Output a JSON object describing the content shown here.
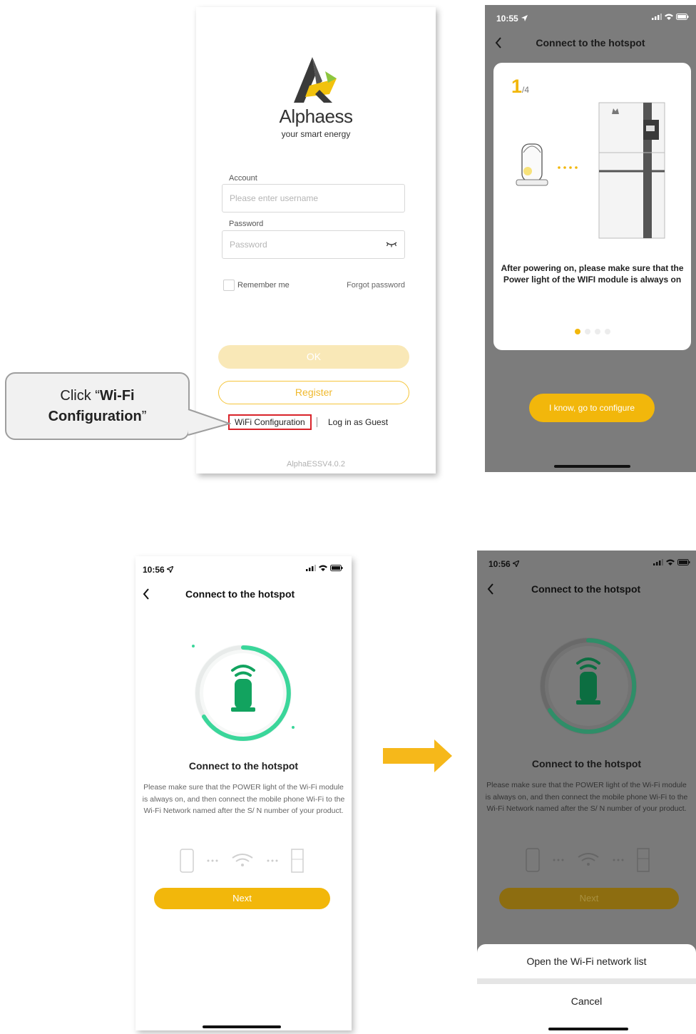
{
  "panel1": {
    "brand": "Alphaess",
    "tagline": "your smart energy",
    "account_label": "Account",
    "account_placeholder": "Please enter username",
    "password_label": "Password",
    "password_placeholder": "Password",
    "remember_label": "Remember me",
    "forgot_label": "Forgot password",
    "ok_label": "OK",
    "register_label": "Register",
    "wifi_config_label": "WiFi Configuration",
    "guest_label": "Log in as Guest",
    "version": "AlphaESSV4.0.2"
  },
  "callout": {
    "prefix": "Click “",
    "bold_line1": "Wi-Fi",
    "bold_line2": "Configuration",
    "suffix": "”"
  },
  "panel2": {
    "time": "10:55",
    "title": "Connect to the hotspot",
    "step_current": "1",
    "step_total": "/4",
    "instruction": "After powering on, please make sure that the Power light of the WIFI module is always on",
    "button_label": "I know, go to configure",
    "page_index": 0,
    "page_count": 4
  },
  "panel3": {
    "time": "10:56",
    "title": "Connect to the hotspot",
    "heading": "Connect to the hotspot",
    "description": "Please make sure that the POWER light of the Wi-Fi module is always on, and then connect the mobile phone Wi-Fi to the Wi-Fi Network named after the S/ N number of your product.",
    "next_label": "Next"
  },
  "panel4": {
    "time": "10:56",
    "title": "Connect to the hotspot",
    "heading": "Connect to the hotspot",
    "description": "Please make sure that the POWER light of the Wi-Fi module is always on, and then connect the mobile phone Wi-Fi to the Wi-Fi Network named after the S/ N number of your product.",
    "next_label": "Next",
    "open_wifi_label": "Open the Wi-Fi network list",
    "cancel_label": "Cancel"
  },
  "colors": {
    "accent_yellow": "#f2b70b",
    "ok_disabled": "#f9e8b7",
    "highlight_red": "#d9232a",
    "ring_green": "#3ad69a",
    "icon_green": "#12a35f"
  }
}
